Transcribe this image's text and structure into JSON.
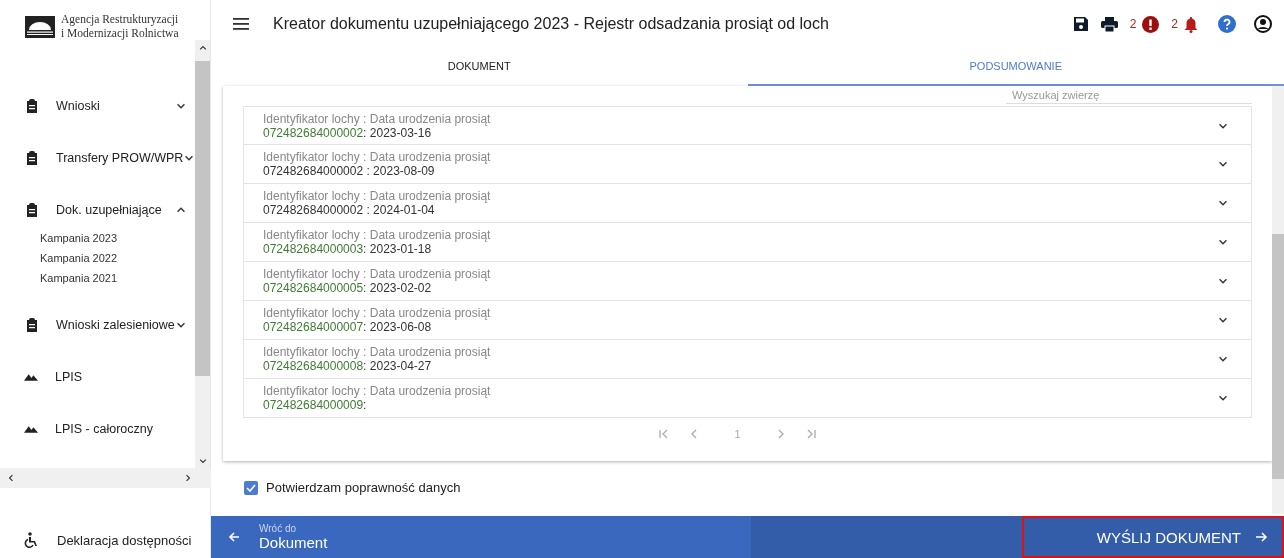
{
  "logo": {
    "line_1": "Agencja Restrukturyzacji",
    "line_2": "i Modernizacji Rolnictwa"
  },
  "sidebar": {
    "items": [
      {
        "kind": "group",
        "label": "Wnioski",
        "expanded": false
      },
      {
        "kind": "group",
        "label": "Transfery PROW/WPR",
        "expanded": false
      },
      {
        "kind": "group",
        "label": "Dok. uzupełniające",
        "expanded": true,
        "children": [
          {
            "label": "Kampania 2023"
          },
          {
            "label": "Kampania 2022"
          },
          {
            "label": "Kampania 2021"
          }
        ]
      },
      {
        "kind": "group",
        "label": "Wnioski zalesieniowe",
        "expanded": false
      },
      {
        "kind": "link",
        "label": "LPIS"
      },
      {
        "kind": "link",
        "label": "LPIS - całoroczny"
      }
    ],
    "footer_item": {
      "label": "Deklaracja dostępności"
    }
  },
  "header": {
    "title": "Kreator dokumentu uzupełniającego 2023 - Rejestr odsadzania prosiąt od loch",
    "error_count": "2",
    "notification_count": "2"
  },
  "tabs": [
    {
      "label": "DOKUMENT",
      "selected": false
    },
    {
      "label": "PODSUMOWANIE",
      "selected": true
    }
  ],
  "search": {
    "placeholder": "Wyszukaj zwierzę"
  },
  "rows": [
    {
      "label": "Identyfikator lochy : Data urodzenia prosiąt",
      "sow_id": "072482684000002",
      "color": "#3f7d32",
      "birth_date": ": 2023-03-16"
    },
    {
      "label": "Identyfikator lochy : Data urodzenia prosiąt",
      "sow_id": "072482684000002",
      "color": "#333333",
      "birth_date": " : 2023-08-09"
    },
    {
      "label": "Identyfikator lochy : Data urodzenia prosiąt",
      "sow_id": "072482684000002",
      "color": "#333333",
      "birth_date": " : 2024-01-04"
    },
    {
      "label": "Identyfikator lochy : Data urodzenia prosiąt",
      "sow_id": "072482684000003",
      "color": "#3f7d32",
      "birth_date": ": 2023-01-18"
    },
    {
      "label": "Identyfikator lochy : Data urodzenia prosiąt",
      "sow_id": "072482684000005",
      "color": "#3f7d32",
      "birth_date": ": 2023-02-02"
    },
    {
      "label": "Identyfikator lochy : Data urodzenia prosiąt",
      "sow_id": "072482684000007",
      "color": "#3f7d32",
      "birth_date": ": 2023-06-08"
    },
    {
      "label": "Identyfikator lochy : Data urodzenia prosiąt",
      "sow_id": "072482684000008",
      "color": "#3f7d32",
      "birth_date": ": 2023-04-27"
    },
    {
      "label": "Identyfikator lochy : Data urodzenia prosiąt",
      "sow_id": "072482684000009",
      "color": "#3f7d32",
      "birth_date": ":"
    }
  ],
  "pagination": {
    "page": "1"
  },
  "confirm": {
    "label": "Potwierdzam poprawność danych",
    "checked": true
  },
  "footer": {
    "back_caption": "Wróć do",
    "back_label": "Dokument",
    "submit_label": "WYŚLIJ DOKUMENT"
  }
}
